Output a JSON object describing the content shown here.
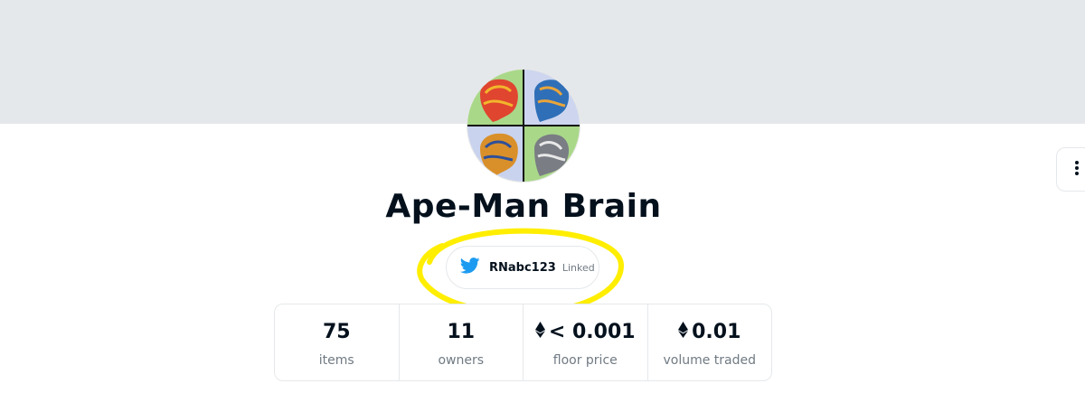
{
  "collection": {
    "name": "Ape-Man Brain"
  },
  "twitter": {
    "handle": "RNabc123",
    "status": "Linked",
    "color": "#1d9bf0"
  },
  "stats": [
    {
      "value": "75",
      "label": "items",
      "currency_icon": false
    },
    {
      "value": "11",
      "label": "owners",
      "currency_icon": false
    },
    {
      "value": "< 0.001",
      "label": "floor price",
      "currency_icon": true
    },
    {
      "value": "0.01",
      "label": "volume traded",
      "currency_icon": true
    }
  ],
  "icons": {
    "twitter": "twitter-bird-icon",
    "more": "more-vertical-icon",
    "currency": "ethereum-icon"
  },
  "colors": {
    "banner": "#e5e8eb",
    "text": "#04111d",
    "muted": "#707a83",
    "highlight": "#ffee00"
  }
}
